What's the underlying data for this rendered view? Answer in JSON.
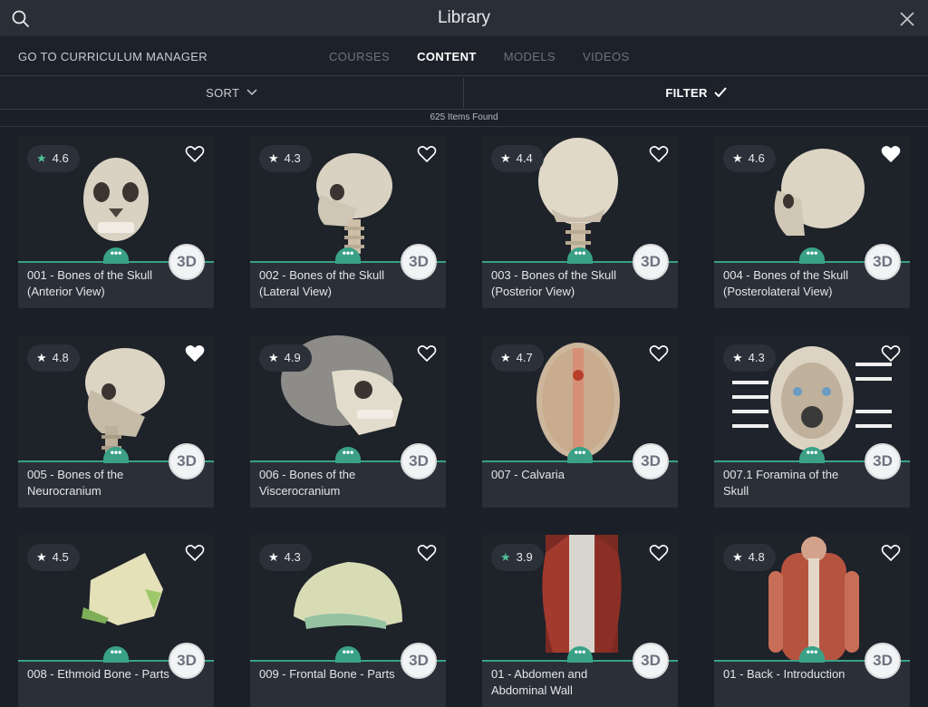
{
  "header": {
    "title": "Library"
  },
  "nav": {
    "curriculum_manager": "GO TO CURRICULUM MANAGER",
    "tabs": [
      {
        "label": "COURSES",
        "active": false
      },
      {
        "label": "CONTENT",
        "active": true
      },
      {
        "label": "MODELS",
        "active": false
      },
      {
        "label": "VIDEOS",
        "active": false
      }
    ]
  },
  "toolbar": {
    "sort_label": "SORT",
    "filter_label": "FILTER"
  },
  "results": {
    "count_text": "625 Items Found"
  },
  "cards": [
    {
      "rating": "4.6",
      "star_color": "green",
      "favorited": false,
      "title_line1": "001 - Bones of the Skull",
      "title_line2": "(Anterior View)",
      "badge": "3D",
      "dots": "•••"
    },
    {
      "rating": "4.3",
      "star_color": "white",
      "favorited": false,
      "title_line1": "002 - Bones of the Skull",
      "title_line2": "(Lateral View)",
      "badge": "3D",
      "dots": "•••"
    },
    {
      "rating": "4.4",
      "star_color": "white",
      "favorited": false,
      "title_line1": "003 - Bones of the Skull",
      "title_line2": "(Posterior View)",
      "badge": "3D",
      "dots": "•••"
    },
    {
      "rating": "4.6",
      "star_color": "white",
      "favorited": true,
      "title_line1": "004 - Bones of the Skull",
      "title_line2": "(Posterolateral View)",
      "badge": "3D",
      "dots": "•••"
    },
    {
      "rating": "4.8",
      "star_color": "white",
      "favorited": true,
      "title_line1": "005 - Bones of the",
      "title_line2": "Neurocranium",
      "badge": "3D",
      "dots": "•••"
    },
    {
      "rating": "4.9",
      "star_color": "white",
      "favorited": false,
      "title_line1": "006 - Bones of the",
      "title_line2": "Viscerocranium",
      "badge": "3D",
      "dots": "•••"
    },
    {
      "rating": "4.7",
      "star_color": "white",
      "favorited": false,
      "title_line1": "007 - Calvaria",
      "title_line2": "",
      "badge": "3D",
      "dots": "•••"
    },
    {
      "rating": "4.3",
      "star_color": "white",
      "favorited": false,
      "title_line1": "007.1 Foramina of the",
      "title_line2": "Skull",
      "badge": "3D",
      "dots": "•••"
    },
    {
      "rating": "4.5",
      "star_color": "white",
      "favorited": false,
      "title_line1": "008 - Ethmoid Bone - Parts",
      "title_line2": "",
      "badge": "3D",
      "dots": "•••"
    },
    {
      "rating": "4.3",
      "star_color": "white",
      "favorited": false,
      "title_line1": "009 - Frontal Bone - Parts",
      "title_line2": "",
      "badge": "3D",
      "dots": "•••"
    },
    {
      "rating": "3.9",
      "star_color": "green",
      "favorited": false,
      "title_line1": "01 - Abdomen and",
      "title_line2": "Abdominal Wall",
      "badge": "3D",
      "dots": "•••"
    },
    {
      "rating": "4.8",
      "star_color": "white",
      "favorited": false,
      "title_line1": "01 - Back - Introduction",
      "title_line2": "",
      "badge": "3D",
      "dots": "•••"
    }
  ],
  "icons": {
    "search": "search-icon",
    "close": "close-icon",
    "star": "star-icon",
    "heart": "heart-icon",
    "chevron": "chevron-down-icon",
    "check": "checkmark-icon"
  },
  "colors": {
    "accent_green": "#3aa186",
    "star_green": "#4ebf95",
    "background": "#1b1f27",
    "card": "#2b3038"
  }
}
